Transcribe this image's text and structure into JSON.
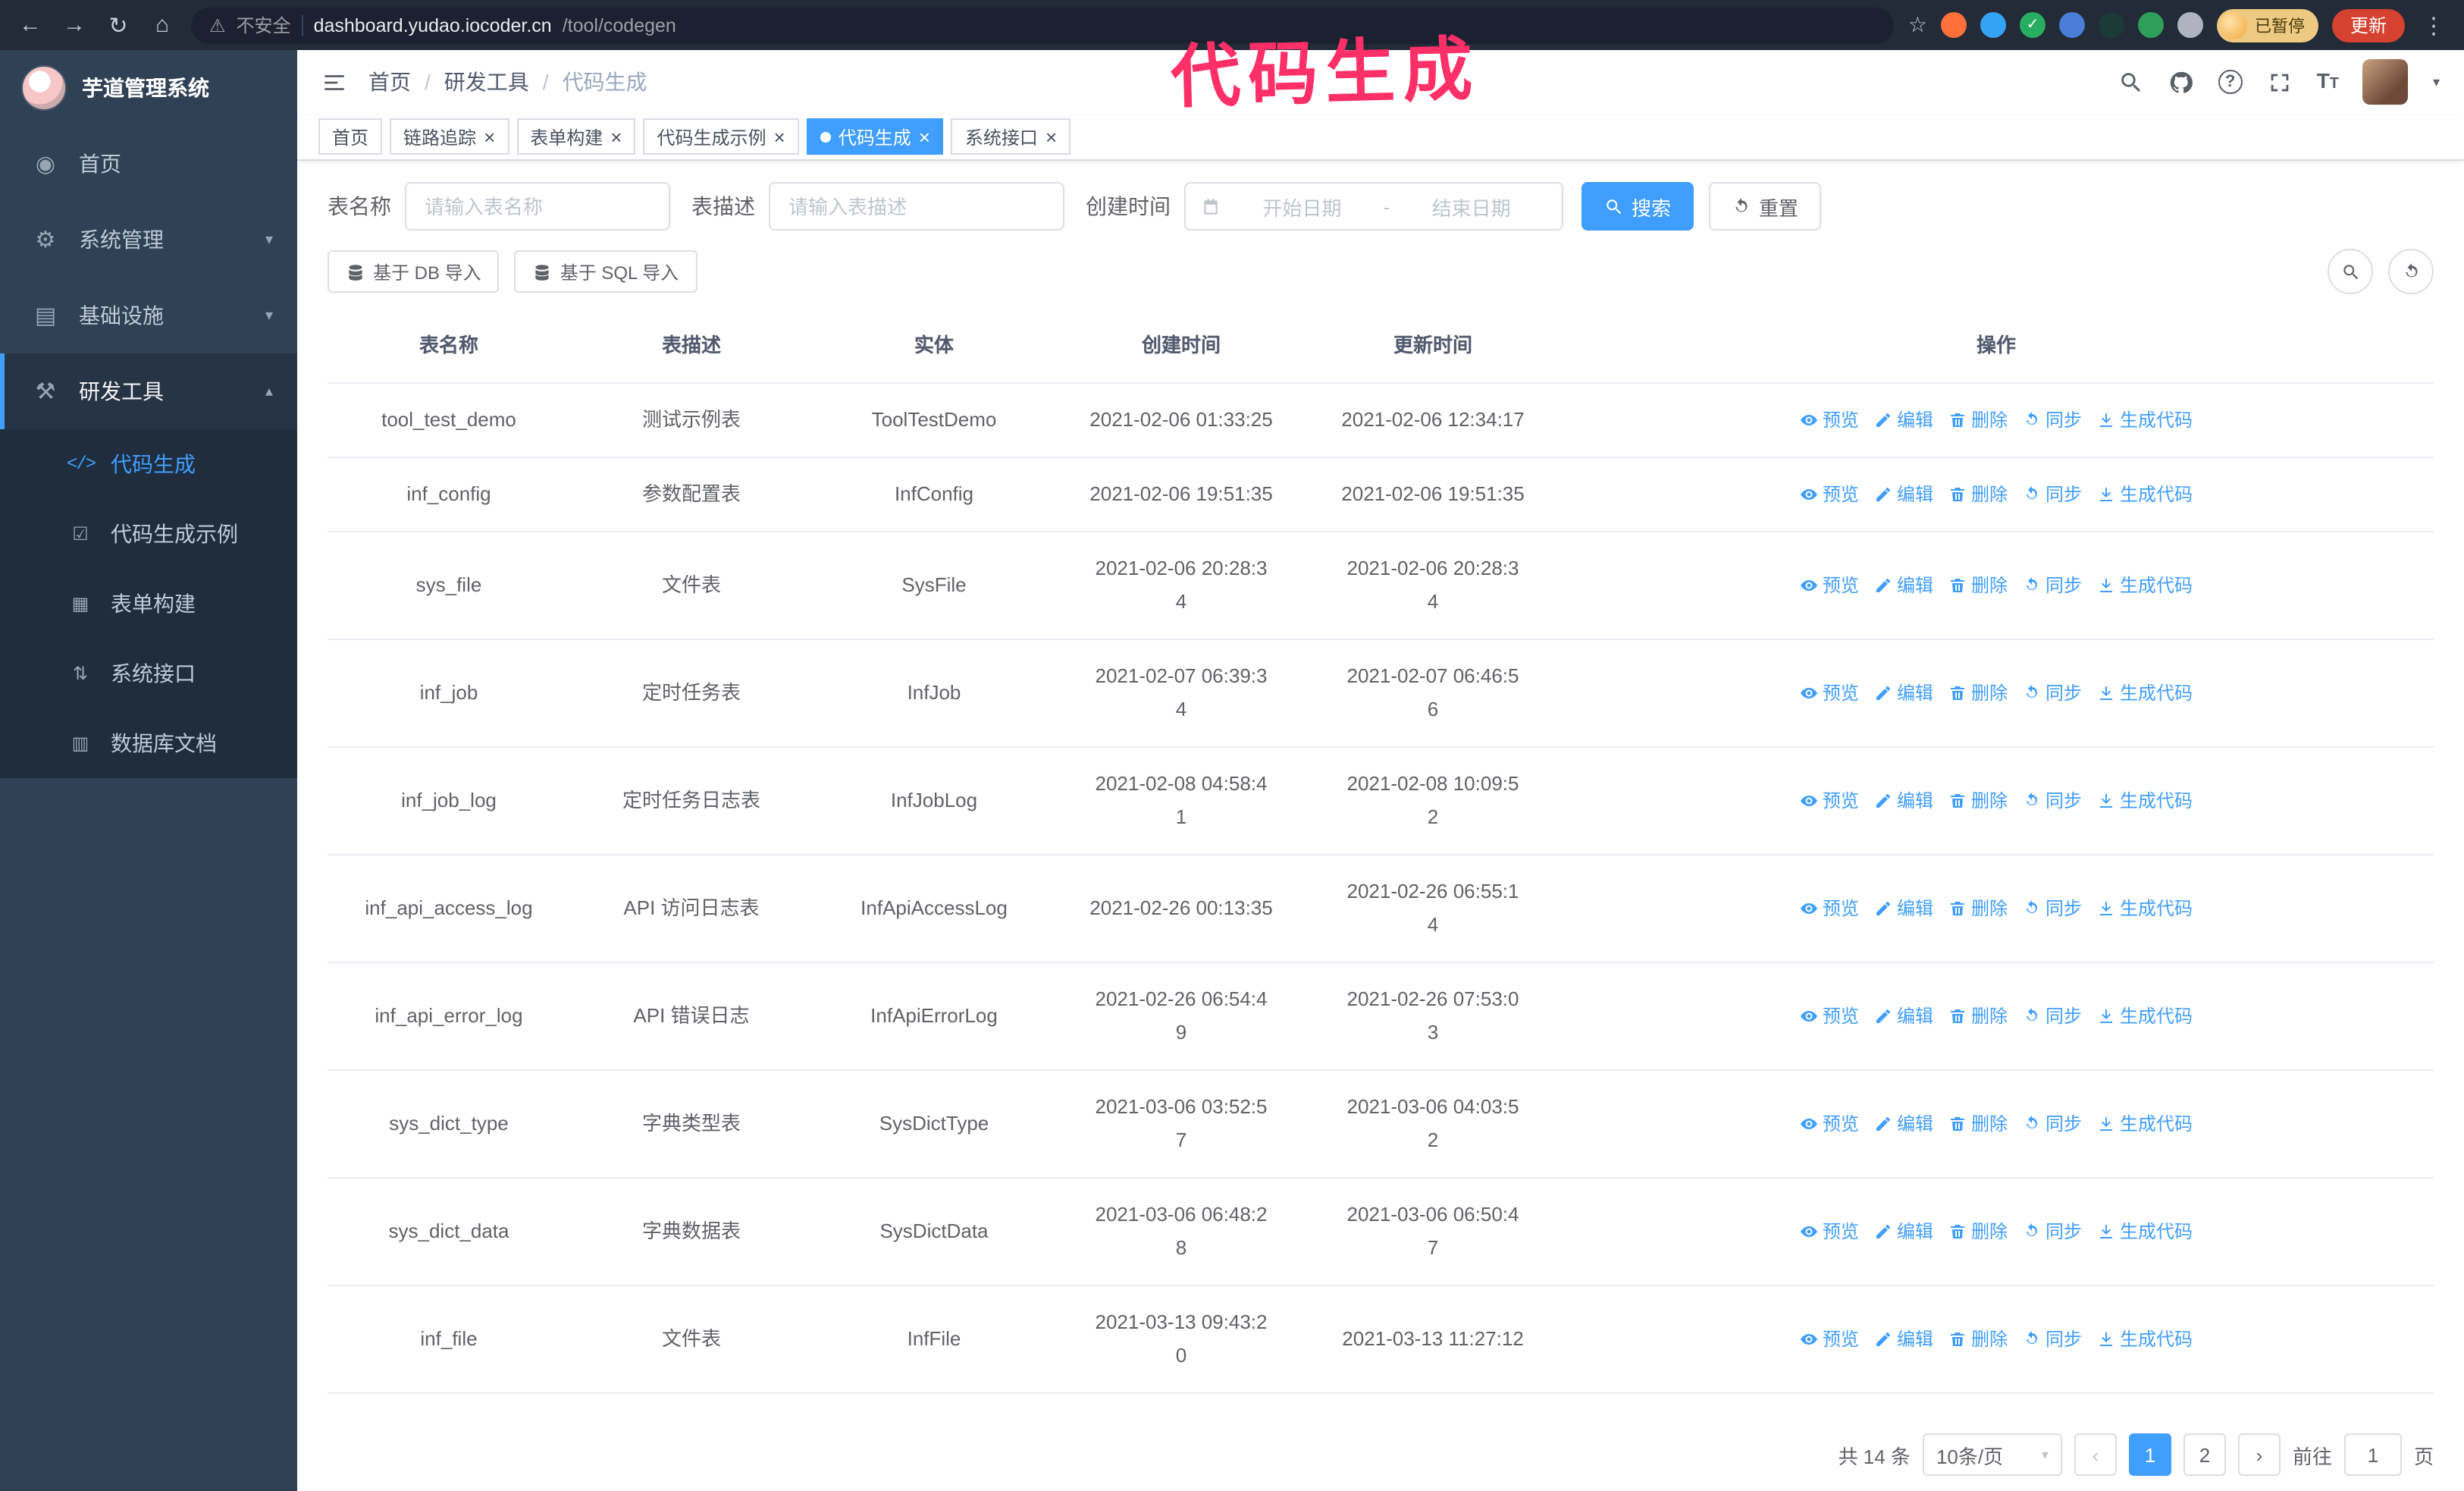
{
  "colors": {
    "accent": "#409eff",
    "sidebar_bg": "#304156",
    "submenu_bg": "#1f2d3d",
    "annotation": "#ff2f68",
    "update_button": "#d5422f"
  },
  "glyphs": {
    "back": "←",
    "forward": "→",
    "reload": "↻",
    "home": "⌂",
    "warning": "⚠",
    "star": "☆",
    "menu_dots": "⋮",
    "breadcrumb_separator": "/",
    "tab_close": "×",
    "chevron_down": "▾",
    "chevron_up": "▴",
    "caret_down": "▾",
    "question": "?",
    "font": "T",
    "prev": "‹",
    "next": "›"
  },
  "annotation": {
    "text": "代码生成"
  },
  "browser": {
    "security_label": "不安全",
    "url_host": "dashboard.yudao.iocoder.cn",
    "url_path": "/tool/codegen",
    "profile_status": "已暂停",
    "update_label": "更新",
    "extensions": [
      {
        "name": "fox-extension-icon",
        "color": "#ff7139",
        "glyph": ""
      },
      {
        "name": "drop-extension-icon",
        "color": "#35a3f5",
        "glyph": ""
      },
      {
        "name": "check-extension-icon",
        "color": "#27ae60",
        "glyph": "✓"
      },
      {
        "name": "people-extension-icon",
        "color": "#4a7dd6",
        "glyph": ""
      },
      {
        "name": "dark-extension-icon",
        "color": "#1d3b36",
        "glyph": ""
      },
      {
        "name": "leaf-extension-icon",
        "color": "#2e9e5b",
        "glyph": ""
      },
      {
        "name": "puzzle-extension-icon",
        "color": "#aeb4bf",
        "glyph": ""
      }
    ]
  },
  "sidebar": {
    "logo_title": "芋道管理系统",
    "items": [
      {
        "label": "首页",
        "icon": "home-icon",
        "expandable": false,
        "active": false,
        "expanded": false
      },
      {
        "label": "系统管理",
        "icon": "gear-icon",
        "expandable": true,
        "active": false,
        "expanded": false
      },
      {
        "label": "基础设施",
        "icon": "infra-icon",
        "expandable": true,
        "active": false,
        "expanded": false
      },
      {
        "label": "研发工具",
        "icon": "tools-icon",
        "expandable": true,
        "active": true,
        "expanded": true
      }
    ],
    "submenu": [
      {
        "label": "代码生成",
        "icon": "code-icon",
        "active": true
      },
      {
        "label": "代码生成示例",
        "icon": "example-icon",
        "active": false
      },
      {
        "label": "表单构建",
        "icon": "form-icon",
        "active": false
      },
      {
        "label": "系统接口",
        "icon": "api-icon",
        "active": false
      },
      {
        "label": "数据库文档",
        "icon": "database-icon",
        "active": false
      }
    ]
  },
  "header": {
    "breadcrumb": [
      "首页",
      "研发工具",
      "代码生成"
    ]
  },
  "tabs": [
    {
      "label": "首页",
      "closable": false,
      "active": false
    },
    {
      "label": "链路追踪",
      "closable": true,
      "active": false
    },
    {
      "label": "表单构建",
      "closable": true,
      "active": false
    },
    {
      "label": "代码生成示例",
      "closable": true,
      "active": false
    },
    {
      "label": "代码生成",
      "closable": true,
      "active": true
    },
    {
      "label": "系统接口",
      "closable": true,
      "active": false
    }
  ],
  "filters": {
    "table_name_label": "表名称",
    "table_name_placeholder": "请输入表名称",
    "table_desc_label": "表描述",
    "table_desc_placeholder": "请输入表描述",
    "create_time_label": "创建时间",
    "date_start_placeholder": "开始日期",
    "date_range_separator": "-",
    "date_end_placeholder": "结束日期",
    "search_label": "搜索",
    "reset_label": "重置"
  },
  "toolbar": {
    "import_db_label": "基于 DB 导入",
    "import_sql_label": "基于 SQL 导入"
  },
  "table": {
    "columns": [
      "表名称",
      "表描述",
      "实体",
      "创建时间",
      "更新时间",
      "操作"
    ],
    "actions": [
      {
        "label": "预览",
        "icon": "eye-icon"
      },
      {
        "label": "编辑",
        "icon": "edit-icon"
      },
      {
        "label": "删除",
        "icon": "delete-icon"
      },
      {
        "label": "同步",
        "icon": "sync-icon"
      },
      {
        "label": "生成代码",
        "icon": "download-icon"
      }
    ],
    "rows": [
      {
        "name": "tool_test_demo",
        "desc": "测试示例表",
        "entity": "ToolTestDemo",
        "created": "2021-02-06 01:33:25",
        "updated": "2021-02-06 12:34:17"
      },
      {
        "name": "inf_config",
        "desc": "参数配置表",
        "entity": "InfConfig",
        "created": "2021-02-06 19:51:35",
        "updated": "2021-02-06 19:51:35"
      },
      {
        "name": "sys_file",
        "desc": "文件表",
        "entity": "SysFile",
        "created": "2021-02-06 20:28:3\n4",
        "updated": "2021-02-06 20:28:3\n4"
      },
      {
        "name": "inf_job",
        "desc": "定时任务表",
        "entity": "InfJob",
        "created": "2021-02-07 06:39:3\n4",
        "updated": "2021-02-07 06:46:5\n6"
      },
      {
        "name": "inf_job_log",
        "desc": "定时任务日志表",
        "entity": "InfJobLog",
        "created": "2021-02-08 04:58:4\n1",
        "updated": "2021-02-08 10:09:5\n2"
      },
      {
        "name": "inf_api_access_log",
        "desc": "API 访问日志表",
        "entity": "InfApiAccessLog",
        "created": "2021-02-26 00:13:35",
        "updated": "2021-02-26 06:55:1\n4"
      },
      {
        "name": "inf_api_error_log",
        "desc": "API 错误日志",
        "entity": "InfApiErrorLog",
        "created": "2021-02-26 06:54:4\n9",
        "updated": "2021-02-26 07:53:0\n3"
      },
      {
        "name": "sys_dict_type",
        "desc": "字典类型表",
        "entity": "SysDictType",
        "created": "2021-03-06 03:52:5\n7",
        "updated": "2021-03-06 04:03:5\n2"
      },
      {
        "name": "sys_dict_data",
        "desc": "字典数据表",
        "entity": "SysDictData",
        "created": "2021-03-06 06:48:2\n8",
        "updated": "2021-03-06 06:50:4\n7"
      },
      {
        "name": "inf_file",
        "desc": "文件表",
        "entity": "InfFile",
        "created": "2021-03-13 09:43:2\n0",
        "updated": "2021-03-13 11:27:12"
      }
    ]
  },
  "pagination": {
    "total_label": "共 14 条",
    "page_size_label": "10条/页",
    "pages": [
      "1",
      "2"
    ],
    "active_page": "1",
    "goto_label": "前往",
    "goto_value": "1",
    "goto_suffix": "页"
  }
}
